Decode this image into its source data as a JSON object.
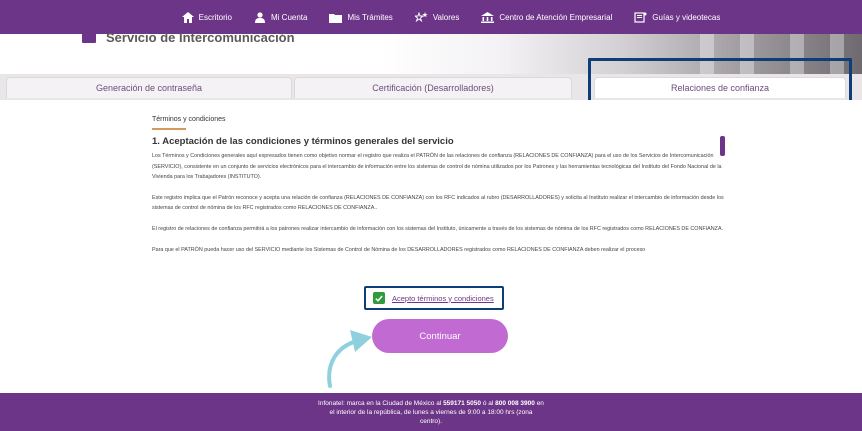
{
  "nav": {
    "items": [
      {
        "label": "Escritorio",
        "icon": "home-icon"
      },
      {
        "label": "Mi Cuenta",
        "icon": "user-icon"
      },
      {
        "label": "Mis Trámites",
        "icon": "folder-icon"
      },
      {
        "label": "Valores",
        "icon": "stars-icon"
      },
      {
        "label": "Centro de Atención Empresarial",
        "icon": "building-icon"
      },
      {
        "label": "Guías y videotecas",
        "icon": "book-icon"
      }
    ]
  },
  "header": {
    "title": "Servicio de Intercomunicación"
  },
  "tabs": [
    {
      "label": "Generación de contraseña"
    },
    {
      "label": "Certificación (Desarrolladores)"
    },
    {
      "label": "Relaciones de confianza"
    }
  ],
  "terms": {
    "section_label": "Términos y condiciones",
    "heading": "1. Aceptación de las condiciones y términos generales del servicio",
    "paragraphs": [
      "Los Términos y Condiciones generales aquí expresados tienen como objetivo normar el registro que realiza el PATRÓN de las relaciones de confianza (RELACIONES DE CONFIANZA) para el uso de los Servicios de Intercomunicación (SERVICIO), consistente en un conjunto de servicios electrónicos para el intercambio de información entre los sistemas de control de nómina utilizados por los Patrones y las herramientas tecnológicas del Instituto del Fondo Nacional de la Vivienda para los Trabajadores (INSTITUTO).",
      "Este registro implica que el Patrón reconoce y acepta una relación de confianza (RELACIONES DE CONFIANZA) con los RFC indicados al rubro (DESARROLLADORES) y solicita al Instituto realizar el intercambio de información desde los sistemas de control de nómina de los RFC registrados como RELACIONES DE CONFIANZA..",
      "El registro de relaciones de confianza permitirá a los patrones realizar intercambio de información con los sistemas del Instituto, únicamente a través de los sistemas de nómina de los RFC registrados como RELACIONES DE CONFIANZA.",
      "Para que el PATRÓN pueda hacer uso del SERVICIO mediante los Sistemas de Control de Nómina de los DESARROLLADORES registrados como RELACIONES DE CONFIANZA deben realizar el proceso"
    ],
    "accept_label": "Acepto términos y condiciones",
    "accepted": true,
    "continue_label": "Continuar"
  },
  "footer": {
    "line1_a": "Infonatel: marca en la Ciudad de México al ",
    "phone1": "559171 5050",
    "line1_b": " ó al ",
    "phone2": "800 008 3900",
    "line1_c": " en",
    "line2": "el interior de la república, de lunes a viernes de 9:00 a 18:00 hrs (zona",
    "line3": "centro)."
  },
  "colors": {
    "brand": "#6d3588",
    "button": "#c06ad2",
    "focus_outline": "#0d3e7a",
    "check": "#2e9c3e"
  }
}
